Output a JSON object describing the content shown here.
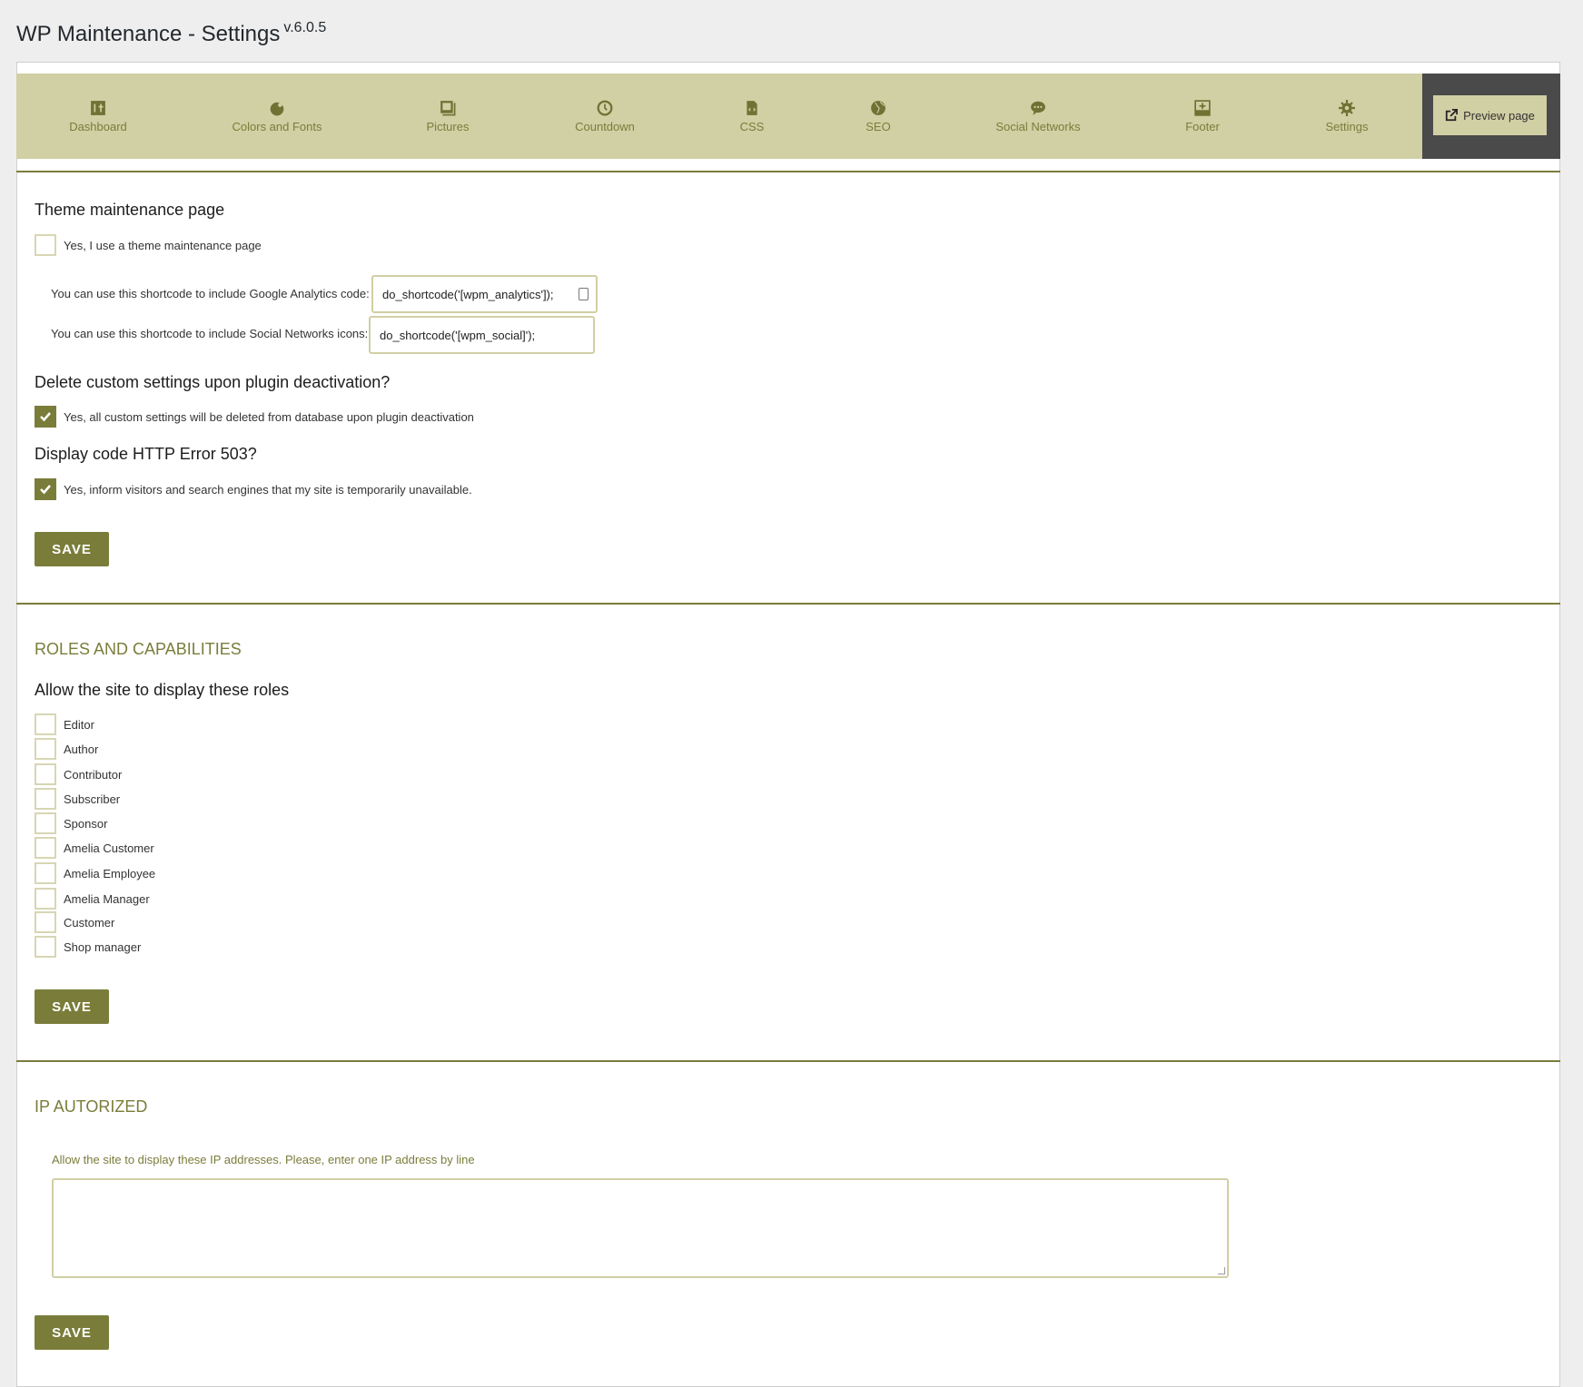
{
  "header": {
    "title": "WP Maintenance - Settings",
    "version": "v.6.0.5"
  },
  "nav": {
    "items": [
      {
        "label": "Dashboard",
        "icon": "dashboard-icon"
      },
      {
        "label": "Colors and Fonts",
        "icon": "palette-icon"
      },
      {
        "label": "Pictures",
        "icon": "pictures-icon"
      },
      {
        "label": "Countdown",
        "icon": "clock-icon"
      },
      {
        "label": "CSS",
        "icon": "css-file-icon"
      },
      {
        "label": "SEO",
        "icon": "globe-icon"
      },
      {
        "label": "Social Networks",
        "icon": "chat-bubble-icon"
      },
      {
        "label": "Footer",
        "icon": "footer-layout-icon"
      },
      {
        "label": "Settings",
        "icon": "gear-icon"
      }
    ],
    "preview_label": "Preview page"
  },
  "colors": {
    "accent": "#7a7d3a",
    "nav_bg": "#d1cfa4",
    "preview_bg": "#4a4a4a"
  },
  "theme": {
    "heading": "Theme maintenance page",
    "checkbox_label": "Yes, I use a theme maintenance page",
    "checked": false,
    "analytics_label": "You can use this shortcode to include Google Analytics code:",
    "analytics_value": "do_shortcode('[wpm_analytics']);",
    "social_label": "You can use this shortcode to include Social Networks icons:",
    "social_value": "do_shortcode('[wpm_social]');"
  },
  "delete": {
    "heading": "Delete custom settings upon plugin deactivation?",
    "checkbox_label": "Yes, all custom settings will be deleted from database upon plugin deactivation",
    "checked": true
  },
  "http503": {
    "heading": "Display code HTTP Error 503?",
    "checkbox_label": "Yes, inform visitors and search engines that my site is temporarily unavailable.",
    "checked": true
  },
  "save_label": "SAVE",
  "roles": {
    "section_title": "ROLES AND CAPABILITIES",
    "heading": "Allow the site to display these roles",
    "items": [
      "Editor",
      "Author",
      "Contributor",
      "Subscriber",
      "Sponsor",
      "Amelia Customer",
      "Amelia Employee",
      "Amelia Manager",
      "Customer",
      "Shop manager"
    ]
  },
  "ip": {
    "section_title": "IP AUTORIZED",
    "label": "Allow the site to display these IP addresses. Please, enter one IP address by line",
    "value": ""
  }
}
